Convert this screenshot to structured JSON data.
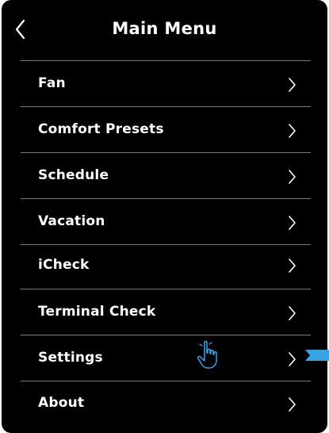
{
  "header": {
    "title": "Main Menu",
    "back_icon": "chevron-left-icon"
  },
  "menu": {
    "items": [
      {
        "label": "Fan",
        "icon": "chevron-right-icon"
      },
      {
        "label": "Comfort Presets",
        "icon": "chevron-right-icon"
      },
      {
        "label": "Schedule",
        "icon": "chevron-right-icon"
      },
      {
        "label": "Vacation",
        "icon": "chevron-right-icon"
      },
      {
        "label": "iCheck",
        "icon": "chevron-right-icon"
      },
      {
        "label": "Terminal Check",
        "icon": "chevron-right-icon"
      },
      {
        "label": "Settings",
        "icon": "chevron-right-icon"
      },
      {
        "label": "About",
        "icon": "chevron-right-icon"
      }
    ]
  },
  "overlay": {
    "hand_icon": "hand-pointer-icon",
    "marker_icon": "blue-arrow-marker-icon",
    "marker_color": "#3aa3e3"
  },
  "colors": {
    "background": "#000000",
    "text": "#ffffff",
    "divider": "#7a7a7a"
  }
}
